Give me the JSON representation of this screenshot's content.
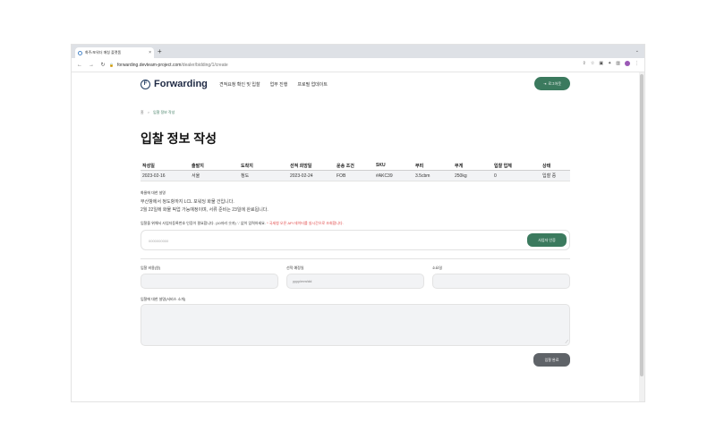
{
  "browser": {
    "tab_title": "화주/포워더 매칭 플랫폼",
    "tab_close": "×",
    "new_tab": "+",
    "url_domain": "forwarding.devteam-project.com",
    "url_path": "/dealer/bidding/1/create"
  },
  "header": {
    "brand": "Forwarding",
    "nav": [
      "견적요청 확인 및 입찰",
      "업무 진행",
      "프로필 업데이트"
    ],
    "login_label": "로그아웃"
  },
  "breadcrumb": {
    "home": "홈",
    "separator": ">",
    "current": "입찰 정보 작성"
  },
  "page_title": "입찰 정보 작성",
  "table": {
    "headers": [
      "작성일",
      "출발지",
      "도착지",
      "선적 희망일",
      "운송 조건",
      "SKU",
      "부피",
      "무게",
      "입찰 업체",
      "상태"
    ],
    "row": [
      "2023-02-16",
      "서울",
      "청도",
      "2023-02-24",
      "FOB",
      "#AKC39",
      "3.5cbm",
      "250kg",
      "0",
      "입찰 중"
    ]
  },
  "cargo": {
    "label": "화물에 대한 설명",
    "line1": "부산항에서 청도항까지 LCL 포워딩 화물 건입니다.",
    "line2": "2월 22일에 화물 픽업 가능예정이며, 서류 준비는 23일에 완료됩니다."
  },
  "business": {
    "note": "입찰을 위해서 사업자등록번호 인증이 필요합니다. (10자리 숫자) '-' 없이 입력하세요.",
    "warning": " * 국세청 오픈 API 데이터를 실시간으로 조회합니다.",
    "placeholder": "0000000000",
    "button": "사업자 인증"
  },
  "form": {
    "price_label": "입찰 비용(원)",
    "date_label": "선적 예정일",
    "date_placeholder": "yyyy/mm/dd",
    "days_label": "소요일",
    "service_label": "입찰에 대한 설명(서비스 소개)",
    "submit": "입찰 완료"
  }
}
